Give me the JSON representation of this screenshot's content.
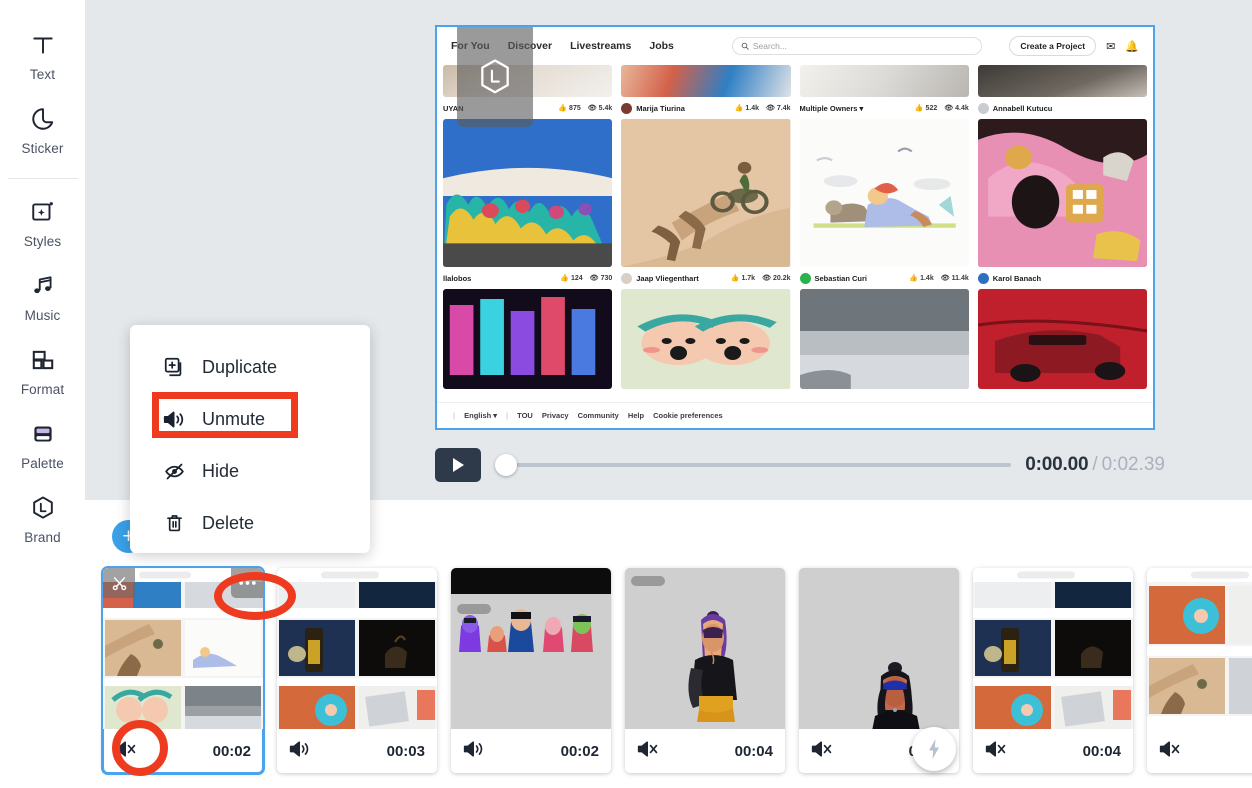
{
  "app": {
    "name": "video-editor",
    "accent_blue": "#3aa0e8",
    "selection_blue": "#4aa3ec",
    "annotation_red": "#ee3b1f",
    "stage_bg": "#e4e8ea"
  },
  "sidebar": {
    "items": [
      {
        "label": "Text",
        "icon": "text-icon"
      },
      {
        "label": "Sticker",
        "icon": "sticker-icon"
      },
      {
        "label": "Styles",
        "icon": "styles-icon"
      },
      {
        "label": "Music",
        "icon": "music-icon"
      },
      {
        "label": "Format",
        "icon": "format-icon"
      },
      {
        "label": "Palette",
        "icon": "palette-icon"
      },
      {
        "label": "Brand",
        "icon": "brand-icon"
      }
    ]
  },
  "context_menu": {
    "items": [
      {
        "label": "Duplicate",
        "icon": "duplicate-icon"
      },
      {
        "label": "Unmute",
        "icon": "speaker-on-icon"
      },
      {
        "label": "Hide",
        "icon": "eye-off-icon"
      },
      {
        "label": "Delete",
        "icon": "trash-icon"
      }
    ],
    "highlighted": "Unmute"
  },
  "canvas": {
    "site": {
      "nav_links": [
        "For You",
        "Discover",
        "Livestreams",
        "Jobs"
      ],
      "search_placeholder": "Search...",
      "create_button": "Create a Project",
      "icons": [
        "mail-icon",
        "bell-icon"
      ],
      "rows": [
        {
          "cards": [
            {
              "author": "UYAN",
              "likes": "875",
              "views": "5.4k",
              "avatar": ""
            },
            {
              "author": "Marija Tiurina",
              "likes": "1.4k",
              "views": "7.4k",
              "avatar": "#7a3b2e"
            },
            {
              "author": "Multiple Owners ▾",
              "likes": "522",
              "views": "4.4k",
              "avatar": ""
            },
            {
              "author": "Annabell Kutucu",
              "likes": "",
              "views": "",
              "avatar": "#c9ccd1"
            }
          ]
        },
        {
          "cards": [
            {
              "author": "llalobos",
              "likes": "124",
              "views": "730",
              "avatar": ""
            },
            {
              "author": "Jaap Vliegenthart",
              "likes": "1.7k",
              "views": "20.2k",
              "avatar": "#d9cfc4"
            },
            {
              "author": "Sebastian Curi",
              "likes": "1.4k",
              "views": "11.4k",
              "avatar": "#2bb24c"
            },
            {
              "author": "Karol Banach",
              "likes": "",
              "views": "",
              "avatar": "#2f6fbf"
            }
          ]
        }
      ],
      "footer": {
        "language": "English ▾",
        "links": [
          "TOU",
          "Privacy",
          "Community",
          "Help",
          "Cookie preferences"
        ]
      }
    }
  },
  "playback": {
    "play_label": "play-icon",
    "current_time": "0:00.00",
    "separator": "/",
    "total_time": "0:02.39",
    "progress_percent": 0
  },
  "timeline": {
    "add_button": "+",
    "transition_button": "lightning-icon",
    "clips": [
      {
        "duration": "00:02",
        "muted": true,
        "selected": true,
        "audio_icon": "speaker-muted-icon"
      },
      {
        "duration": "00:03",
        "muted": false,
        "selected": false,
        "audio_icon": "speaker-on-icon"
      },
      {
        "duration": "00:02",
        "muted": false,
        "selected": false,
        "audio_icon": "speaker-on-icon"
      },
      {
        "duration": "00:04",
        "muted": true,
        "selected": false,
        "audio_icon": "speaker-muted-icon"
      },
      {
        "duration": "00:03",
        "muted": true,
        "selected": false,
        "audio_icon": "speaker-muted-icon"
      },
      {
        "duration": "00:04",
        "muted": true,
        "selected": false,
        "audio_icon": "speaker-muted-icon"
      },
      {
        "duration": "",
        "muted": true,
        "selected": false,
        "audio_icon": "speaker-muted-icon"
      }
    ],
    "clip_tools": {
      "split": "scissors-icon",
      "more": "more-options-icon"
    }
  },
  "annotations": [
    {
      "shape": "rectangle",
      "target": "Unmute menu item"
    },
    {
      "shape": "ellipse",
      "target": "clip more-options button"
    },
    {
      "shape": "circle",
      "target": "clip mute indicator"
    }
  ]
}
